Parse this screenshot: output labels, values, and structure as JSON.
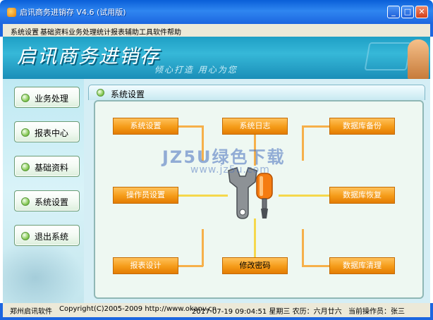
{
  "window": {
    "title": "启讯商务进销存 V4.6 (试用版)",
    "min_label": "_",
    "max_label": "□",
    "close_label": "✕"
  },
  "menu": [
    "系统设置",
    "基础资料",
    "业务处理",
    "统计报表",
    "辅助工具",
    "软件帮助"
  ],
  "banner": {
    "title": "启讯商务进销存",
    "slogan": "倾心打造  用心为您"
  },
  "sidebar": {
    "items": [
      {
        "label": "业务处理"
      },
      {
        "label": "报表中心"
      },
      {
        "label": "基础资料"
      },
      {
        "label": "系统设置"
      },
      {
        "label": "退出系统"
      }
    ]
  },
  "panel": {
    "title": "系统设置",
    "buttons": {
      "system_settings": "系统设置",
      "system_log": "系统日志",
      "db_backup": "数据库备份",
      "operator_settings": "操作员设置",
      "db_restore": "数据库恢复",
      "report_design": "报表设计",
      "change_password": "修改密码",
      "db_cleanup": "数据库清理"
    }
  },
  "watermark": {
    "line1": "JZ5U绿色下载",
    "line2": "www.jz5u.com"
  },
  "status": {
    "company": "郑州启讯软件",
    "copyright": "Copyright(C)2005-2009 http://www.okanv.cn",
    "datetime": "2017-07-19 09:04:51 星期三 农历：六月廿六",
    "operator": "当前操作员：张三"
  },
  "colors": {
    "titlebar": "#1c66e0",
    "banner": "#2aa9cc",
    "function_button": "#f59b18",
    "connector_orange": "#f6b04a",
    "connector_yellow": "#f5d84c"
  }
}
